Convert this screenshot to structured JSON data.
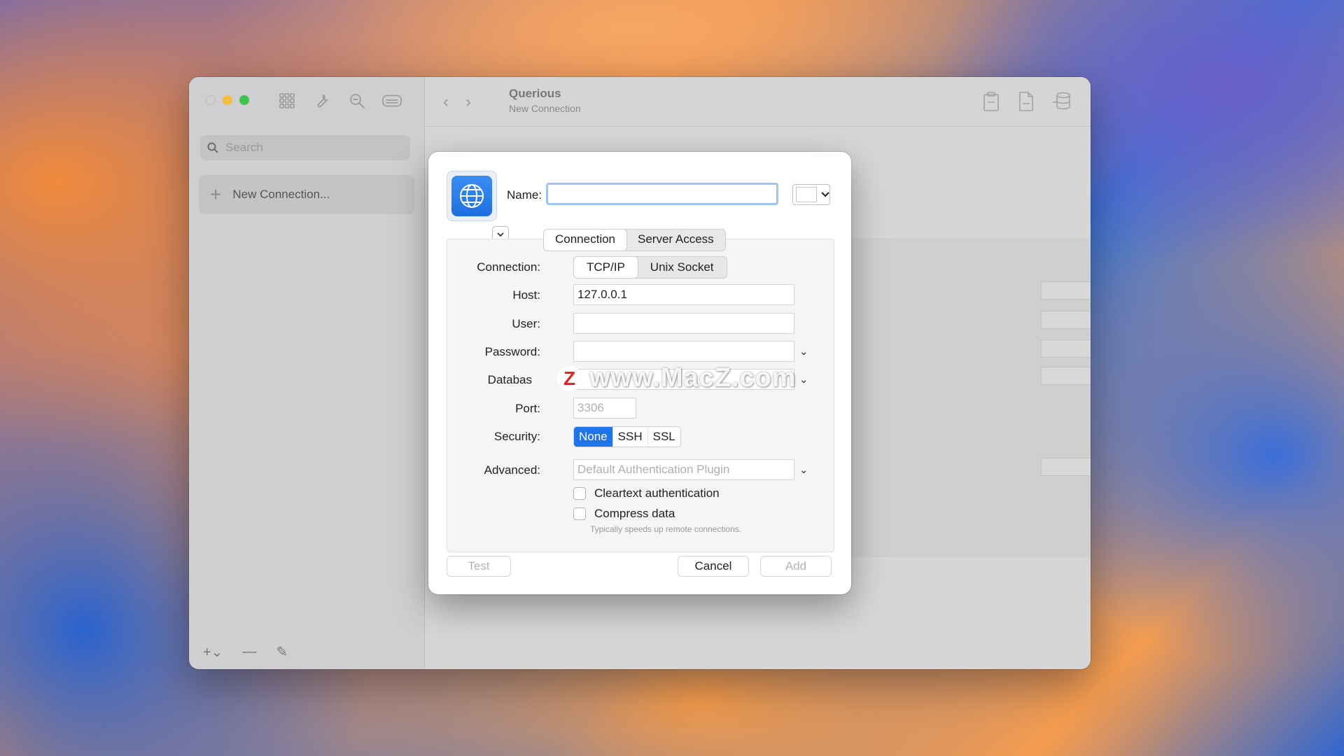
{
  "window": {
    "title": "Querious",
    "subtitle": "New Connection"
  },
  "sidebar": {
    "search_placeholder": "Search",
    "items": [
      {
        "label": "New Connection..."
      }
    ]
  },
  "dialog": {
    "name_label": "Name:",
    "name_value": "",
    "tabs": [
      {
        "label": "Connection",
        "active": true
      },
      {
        "label": "Server Access",
        "active": false
      }
    ],
    "connection_label": "Connection:",
    "connection_options": [
      "TCP/IP",
      "Unix Socket"
    ],
    "connection_selected": "TCP/IP",
    "host_label": "Host:",
    "host_value": "127.0.0.1",
    "user_label": "User:",
    "user_value": "",
    "password_label": "Password:",
    "password_value": "",
    "database_label": "Databas",
    "database_value": "",
    "port_label": "Port:",
    "port_placeholder": "3306",
    "security_label": "Security:",
    "security_options": [
      "None",
      "SSH",
      "SSL"
    ],
    "security_selected": "None",
    "advanced_label": "Advanced:",
    "advanced_placeholder": "Default Authentication Plugin",
    "cleartext_label": "Cleartext authentication",
    "compress_label": "Compress data",
    "compress_hint": "Typically speeds up remote connections.",
    "test_label": "Test",
    "cancel_label": "Cancel",
    "add_label": "Add"
  },
  "watermark": {
    "text": "www.MacZ.com",
    "logo_letter": "Z"
  },
  "colors": {
    "accent": "#1f74ea",
    "focus_ring": "#9ec3f5",
    "close_dot": "#cfcfcf",
    "min_dot": "#f5bd3f",
    "max_dot": "#3ec44c"
  },
  "icons": [
    "grid-icon",
    "wrench-icon",
    "magnify-icon",
    "keyboard-icon",
    "back-chevron-icon",
    "forward-chevron-icon",
    "clipboard-icon",
    "document-icon",
    "database-icon",
    "globe-icon"
  ]
}
